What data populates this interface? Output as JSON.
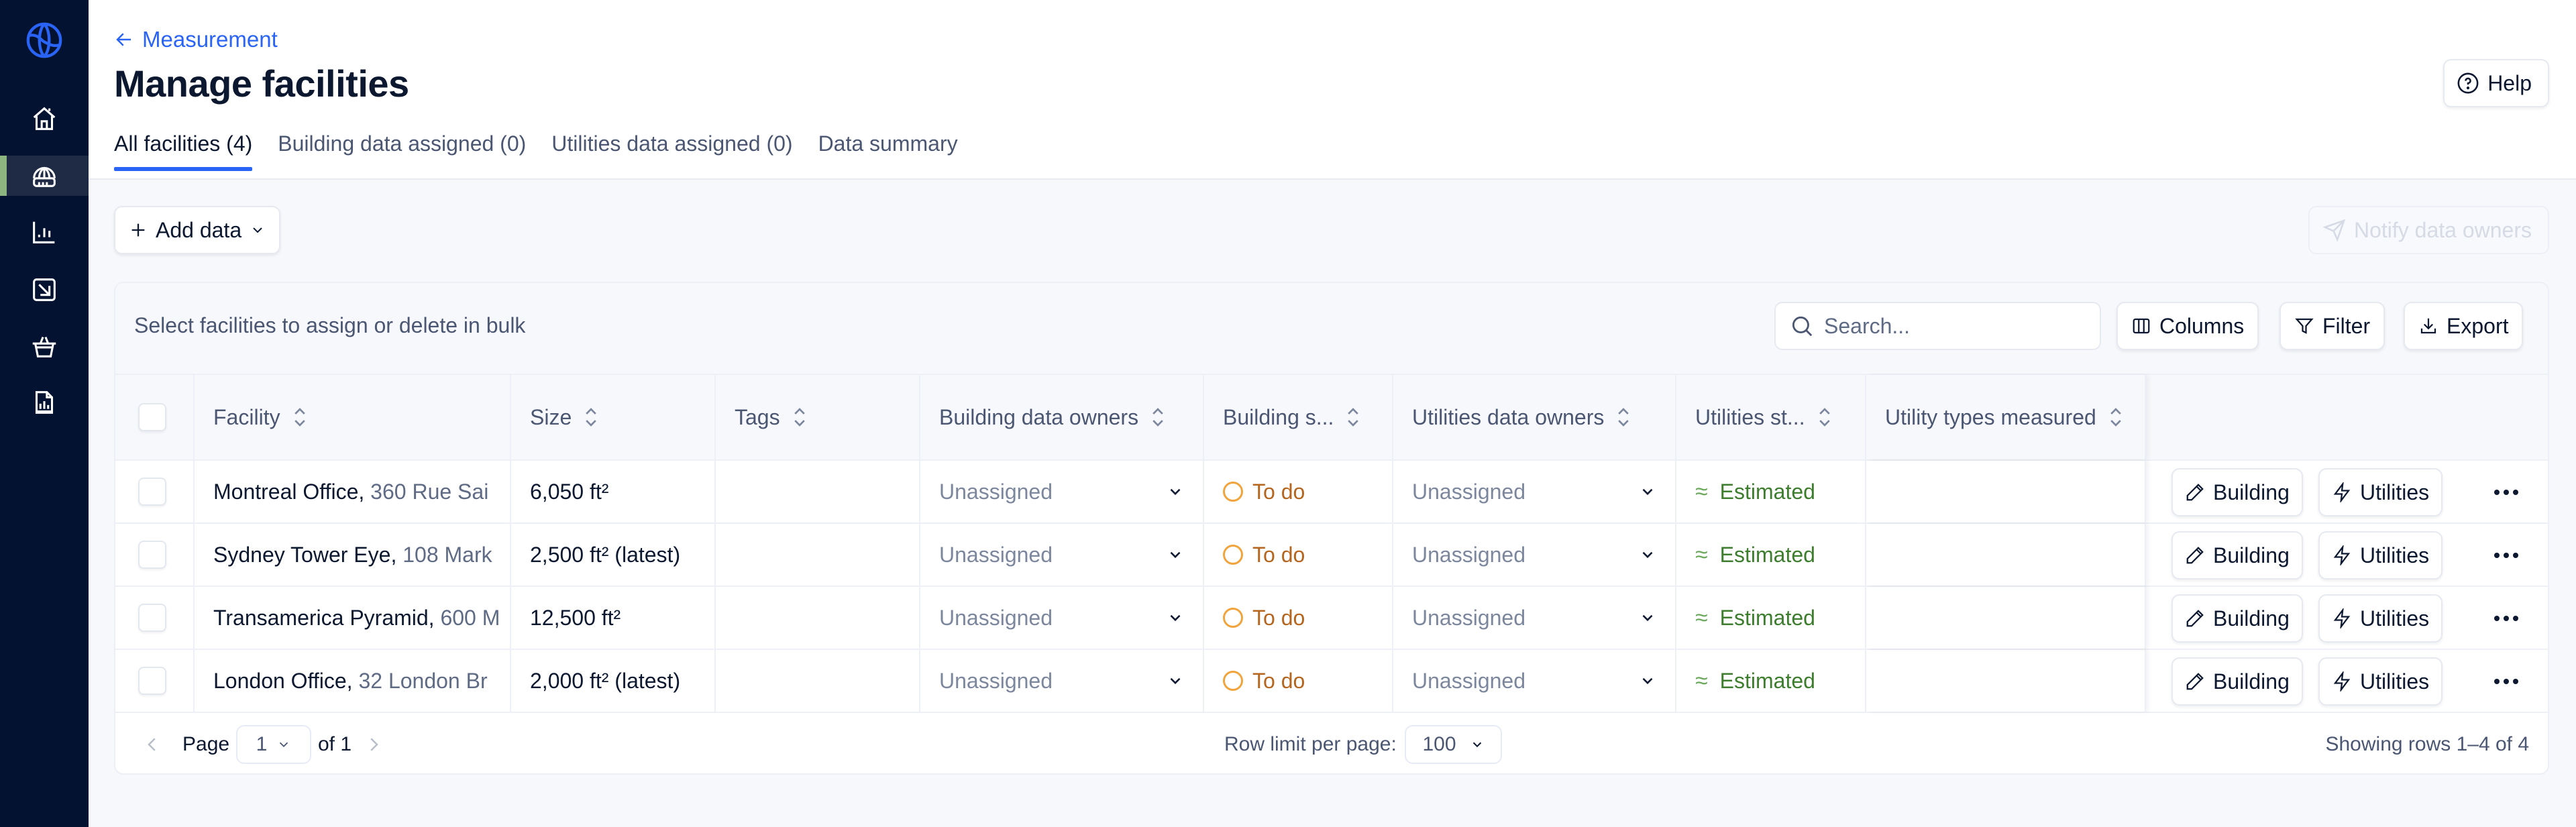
{
  "sidebar": {
    "logo": "globe-logo-icon",
    "items": [
      {
        "icon": "home-icon",
        "active": false
      },
      {
        "icon": "facilities-icon",
        "active": true
      },
      {
        "icon": "bar-chart-icon",
        "active": false
      },
      {
        "icon": "arrow-down-right-box-icon",
        "active": false
      },
      {
        "icon": "basket-icon",
        "active": false
      },
      {
        "icon": "report-file-icon",
        "active": false
      }
    ],
    "accent_color": "#8db57f"
  },
  "header": {
    "breadcrumb": "Measurement",
    "title": "Manage facilities",
    "help_label": "Help",
    "tabs": [
      {
        "label": "All facilities (4)",
        "active": true
      },
      {
        "label": "Building data assigned (0)",
        "active": false
      },
      {
        "label": "Utilities data assigned (0)",
        "active": false
      },
      {
        "label": "Data summary",
        "active": false
      }
    ]
  },
  "actions": {
    "add_data_label": "Add data",
    "notify_label": "Notify data owners",
    "notify_disabled": true
  },
  "table_toolbar": {
    "bulk_hint": "Select facilities to assign or delete in bulk",
    "search_placeholder": "Search...",
    "columns_label": "Columns",
    "filter_label": "Filter",
    "export_label": "Export"
  },
  "table": {
    "columns": [
      "Facility",
      "Size",
      "Tags",
      "Building data owners",
      "Building s...",
      "Utilities data owners",
      "Utilities st...",
      "Utility types measured"
    ],
    "rows": [
      {
        "name": "Montreal Office,",
        "address": "360 Rue Sai",
        "size": "6,050 ft²",
        "tags": "",
        "building_owner": "Unassigned",
        "building_status": "To do",
        "utilities_owner": "Unassigned",
        "utilities_status": "Estimated",
        "utility_types": ""
      },
      {
        "name": "Sydney Tower Eye,",
        "address": "108 Mark",
        "size": "2,500 ft² (latest)",
        "tags": "",
        "building_owner": "Unassigned",
        "building_status": "To do",
        "utilities_owner": "Unassigned",
        "utilities_status": "Estimated",
        "utility_types": ""
      },
      {
        "name": "Transamerica Pyramid,",
        "address": "600 M",
        "size": "12,500 ft²",
        "tags": "",
        "building_owner": "Unassigned",
        "building_status": "To do",
        "utilities_owner": "Unassigned",
        "utilities_status": "Estimated",
        "utility_types": ""
      },
      {
        "name": "London Office,",
        "address": "32 London Br",
        "size": "2,000 ft² (latest)",
        "tags": "",
        "building_owner": "Unassigned",
        "building_status": "To do",
        "utilities_owner": "Unassigned",
        "utilities_status": "Estimated",
        "utility_types": ""
      }
    ],
    "row_actions": {
      "building_label": "Building",
      "utilities_label": "Utilities"
    }
  },
  "pagination": {
    "page_label": "Page",
    "current_page": "1",
    "of_label": "of 1",
    "row_limit_label": "Row limit per page:",
    "row_limit": "100",
    "showing": "Showing rows 1–4 of 4"
  },
  "colors": {
    "brand_blue": "#2a64f6",
    "sidebar_bg": "#021230",
    "todo_orange": "#f1a43c",
    "estimated_green": "#3d7d2e"
  }
}
